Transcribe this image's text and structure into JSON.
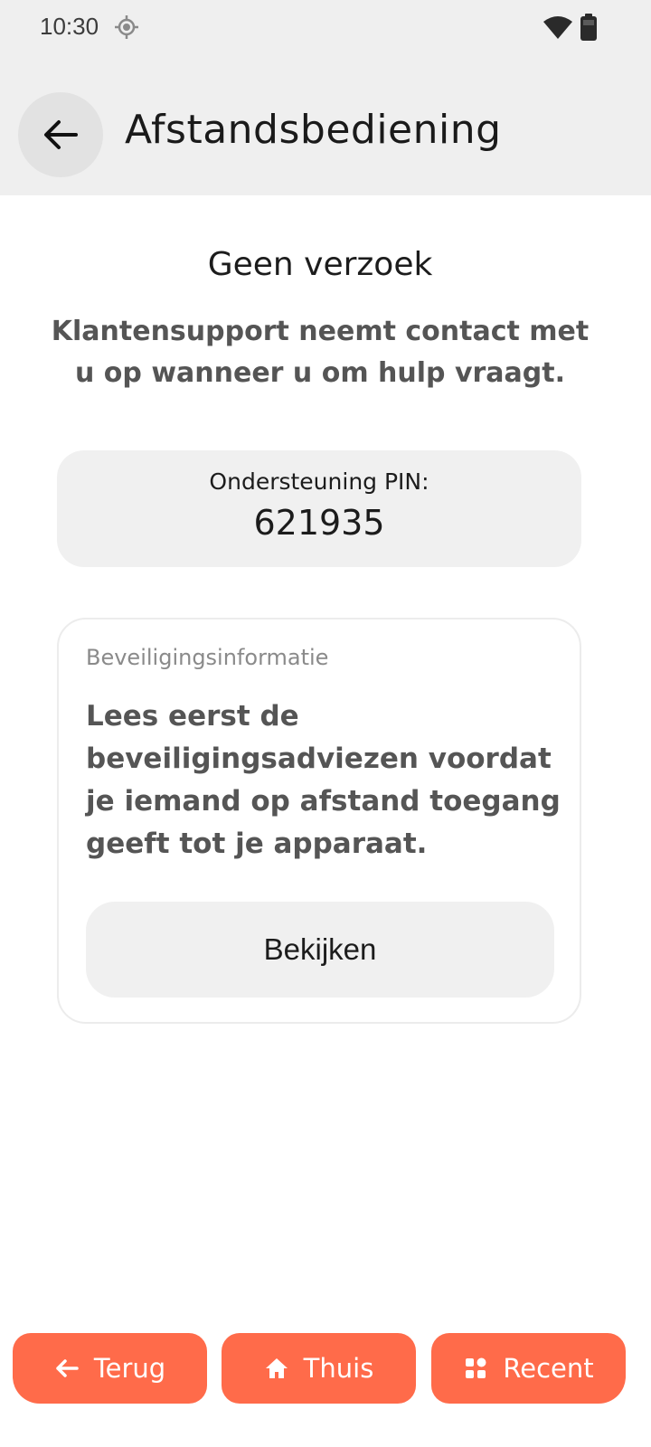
{
  "status_bar": {
    "time": "10:30",
    "icons": [
      "location-icon",
      "wifi-icon",
      "battery-icon"
    ]
  },
  "header": {
    "title": "Afstandsbediening",
    "back_icon": "arrow-left-icon"
  },
  "main": {
    "heading": "Geen verzoek",
    "description": "Klantensupport neemt contact met u op wanneer u om hulp vraagt.",
    "pin": {
      "label": "Ondersteuning PIN:",
      "value": "621935"
    },
    "security": {
      "title": "Beveiligingsinformatie",
      "body": "Lees eerst de beveiligingsadviezen voordat je iemand op afstand toegang geeft tot je apparaat.",
      "button_label": "Bekijken"
    }
  },
  "nav": {
    "back_label": "Terug",
    "home_label": "Thuis",
    "recent_label": "Recent"
  },
  "colors": {
    "accent": "#ff6b4a",
    "header_bg": "#efefef",
    "card_bg": "#f0f0f0"
  }
}
